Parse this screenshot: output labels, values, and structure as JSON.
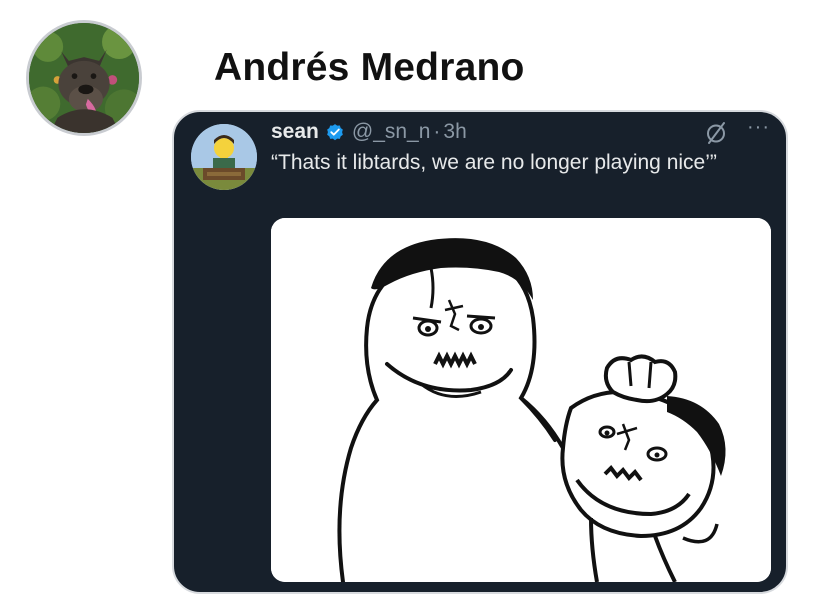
{
  "post": {
    "author_name": "Andrés Medrano",
    "author_avatar_icon": "dog-photo-avatar"
  },
  "quoted_tweet": {
    "display_name": "sean",
    "verified_icon": "verified-check-icon",
    "handle": "@_sn_n",
    "separator": "·",
    "time": "3h",
    "text": "“Thats it libtards, we are no longer playing nice’”",
    "grok_icon": "grok-slash-icon",
    "more_icon": "···",
    "media": "meme-image",
    "colors": {
      "card_background": "#17202b",
      "primary_text": "#e7e9ea",
      "secondary_text": "#8b98a5",
      "verified": "#1d9bf0"
    }
  }
}
